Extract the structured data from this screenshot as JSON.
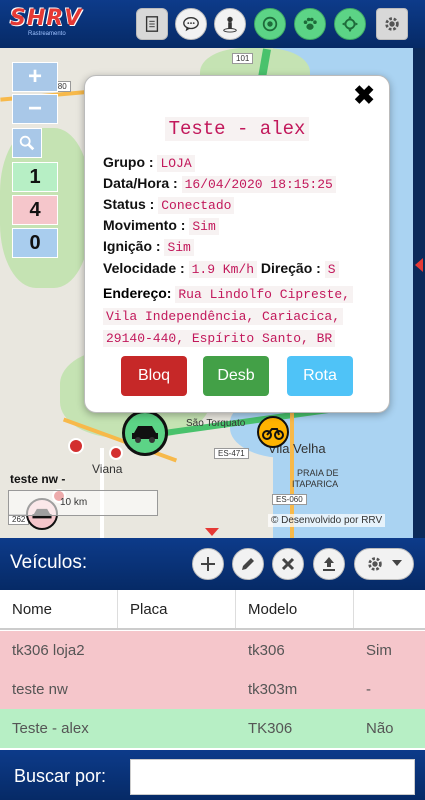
{
  "app": {
    "logo_text": "SHRV",
    "logo_sub": "Rastreamento"
  },
  "toolbar": {
    "icons": [
      "document-icon",
      "chat-icon",
      "person-pin-icon",
      "target-icon",
      "paw-icon",
      "crosshair-icon",
      "gear-icon"
    ]
  },
  "map": {
    "zoom_in": "+",
    "zoom_out": "−",
    "counts": [
      {
        "value": "1",
        "color": "#b7efc5"
      },
      {
        "value": "4",
        "color": "#f5c6cb"
      },
      {
        "value": "0",
        "color": "#a9cdee"
      }
    ],
    "labels": {
      "sao_torquato": "São Torquato",
      "viana": "Viana",
      "vila_velha": "Vila Velha",
      "praia": "PRAIA DE",
      "itaparica": "ITAPARICA",
      "es471": "ES-471",
      "es060": "ES-060",
      "es080": "ES-080",
      "br101": "101",
      "br262": "262"
    },
    "unit_label": "teste nw -",
    "scale": "10 km",
    "credit": "© Desenvolvido por RRV"
  },
  "popup": {
    "title": "Teste - alex",
    "grupo_label": "Grupo :",
    "grupo": "LOJA",
    "datahora_label": "Data/Hora :",
    "datahora": "16/04/2020 18:15:25",
    "status_label": "Status :",
    "status": "Conectado",
    "movimento_label": "Movimento :",
    "movimento": "Sim",
    "ignicao_label": "Ignição :",
    "ignicao": "Sim",
    "velocidade_label": "Velocidade :",
    "velocidade": "1.9 Km/h",
    "direcao_label": "Direção :",
    "direcao": "S",
    "endereco_label": "Endereço:",
    "endereco_l1": "Rua Lindolfo Cipreste,",
    "endereco_l2": "Vila  Independência,  Cariacica,",
    "endereco_l3": "29140-440, Espírito Santo, BR",
    "btn_bloq": "Bloq",
    "btn_desb": "Desb",
    "btn_rota": "Rota",
    "colors": {
      "bloq": "#c62828",
      "desb": "#43a047",
      "rota": "#4fc3f7"
    }
  },
  "vehicles": {
    "title": "Veículos:",
    "columns": [
      "Nome",
      "Placa",
      "Modelo",
      ""
    ],
    "rows": [
      {
        "nome": "tk306 loja2",
        "placa": "",
        "modelo": "tk306",
        "mov": "Sim",
        "color": "#f5c6cb"
      },
      {
        "nome": "teste nw",
        "placa": "",
        "modelo": "tk303m",
        "mov": "-",
        "color": "#f5c6cb"
      },
      {
        "nome": "Teste - alex",
        "placa": "",
        "modelo": "TK306",
        "mov": "Não",
        "color": "#b7efc5"
      }
    ]
  },
  "search": {
    "label": "Buscar por:",
    "value": "",
    "placeholder": ""
  }
}
